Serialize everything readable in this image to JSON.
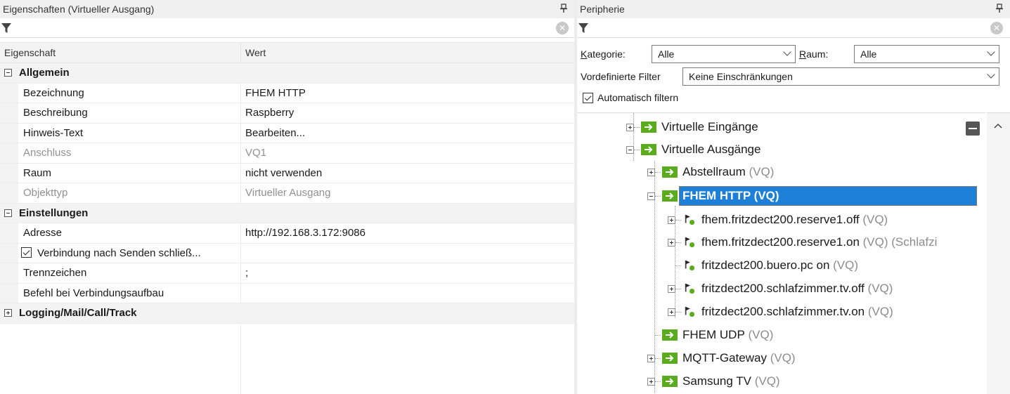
{
  "left_panel": {
    "title": "Eigenschaften (Virtueller Ausgang)",
    "grid_header": {
      "property": "Eigenschaft",
      "value": "Wert"
    },
    "categories": [
      {
        "label": "Allgemein",
        "rows": [
          {
            "name": "Bezeichnung",
            "value": "FHEM HTTP",
            "dim": false
          },
          {
            "name": "Beschreibung",
            "value": "Raspberry",
            "dim": false
          },
          {
            "name": "Hinweis-Text",
            "value": "Bearbeiten...",
            "dim": false
          },
          {
            "name": "Anschluss",
            "value": "VQ1",
            "dim": true
          },
          {
            "name": "Raum",
            "value": "nicht verwenden",
            "dim": false
          },
          {
            "name": "Objekttyp",
            "value": "Virtueller Ausgang",
            "dim": true
          }
        ]
      },
      {
        "label": "Einstellungen",
        "rows": [
          {
            "name": "Adresse",
            "value": "http://192.168.3.172:9086"
          },
          {
            "name": "Verbindung nach Senden schließ...",
            "value": "",
            "checked": true
          },
          {
            "name": "Trennzeichen",
            "value": ";"
          },
          {
            "name": "Befehl bei Verbindungsaufbau",
            "value": ""
          }
        ]
      },
      {
        "label": "Logging/Mail/Call/Track"
      }
    ]
  },
  "right_panel": {
    "title": "Peripherie",
    "kategorie_label": "Kategorie:",
    "kategorie_value": "Alle",
    "raum_label": "Raum:",
    "raum_value": "Alle",
    "filter_label": "Vordefinierte Filter",
    "filter_value": "Keine Einschränkungen",
    "auto_filter_label": "Automatisch filtern",
    "auto_filter_checked": true,
    "tree": {
      "virtual_inputs": "Virtuelle Eingänge",
      "virtual_outputs": "Virtuelle Ausgänge",
      "abstellraum": "Abstellraum",
      "fhem_http": "FHEM HTTP (VQ)",
      "children": [
        {
          "label": "fhem.fritzdect200.reserve1.off",
          "suffix": "(VQ)"
        },
        {
          "label": "fhem.fritzdect200.reserve1.on",
          "suffix": "(VQ) (Schlafzi"
        },
        {
          "label": "fritzdect200.buero.pc on",
          "suffix": "(VQ)"
        },
        {
          "label": "fritzdect200.schlafzimmer.tv.off",
          "suffix": "(VQ)"
        },
        {
          "label": "fritzdect200.schlafzimmer.tv.on",
          "suffix": "(VQ)"
        }
      ],
      "fhem_udp": "FHEM UDP",
      "mqtt": "MQTT-Gateway",
      "samsung": "Samsung TV",
      "vq_suffix": "(VQ)"
    }
  },
  "colors": {
    "selection": "#1e7fd8",
    "green_icon": "#5aab1e",
    "dim_text": "#909090"
  },
  "icons": [
    "pin-icon",
    "funnel-icon",
    "clear-icon",
    "chevron-down-icon",
    "virtual-output-icon",
    "command-icon",
    "collapse-all-icon",
    "scroll-up-icon"
  ]
}
